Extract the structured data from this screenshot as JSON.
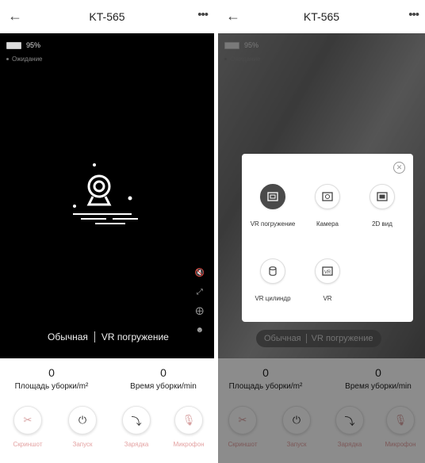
{
  "app": {
    "title": "KT-565"
  },
  "status": {
    "battery": "95%",
    "state": "Ожидание"
  },
  "modes": {
    "normal": "Обычная",
    "vr": "VR погружение"
  },
  "stats": {
    "area_value": "0",
    "area_label": "Площадь уборки/m²",
    "time_value": "0",
    "time_label": "Время уборки/min"
  },
  "controls": {
    "screenshot": "Скриншот",
    "start": "Запуск",
    "charge": "Зарядка",
    "mic": "Микрофон"
  },
  "dialog": {
    "options": [
      {
        "label": "VR погружение",
        "icon": "vr-immersion-icon",
        "active": true
      },
      {
        "label": "Камера",
        "icon": "camera-icon",
        "active": false
      },
      {
        "label": "2D вид",
        "icon": "2d-view-icon",
        "active": false
      },
      {
        "label": "VR цилиндр",
        "icon": "cylinder-icon",
        "active": false
      },
      {
        "label": "VR",
        "icon": "vr-icon",
        "active": false
      }
    ]
  },
  "colors": {
    "control_label": "#e4a2a2",
    "video_bg": "#000000"
  }
}
